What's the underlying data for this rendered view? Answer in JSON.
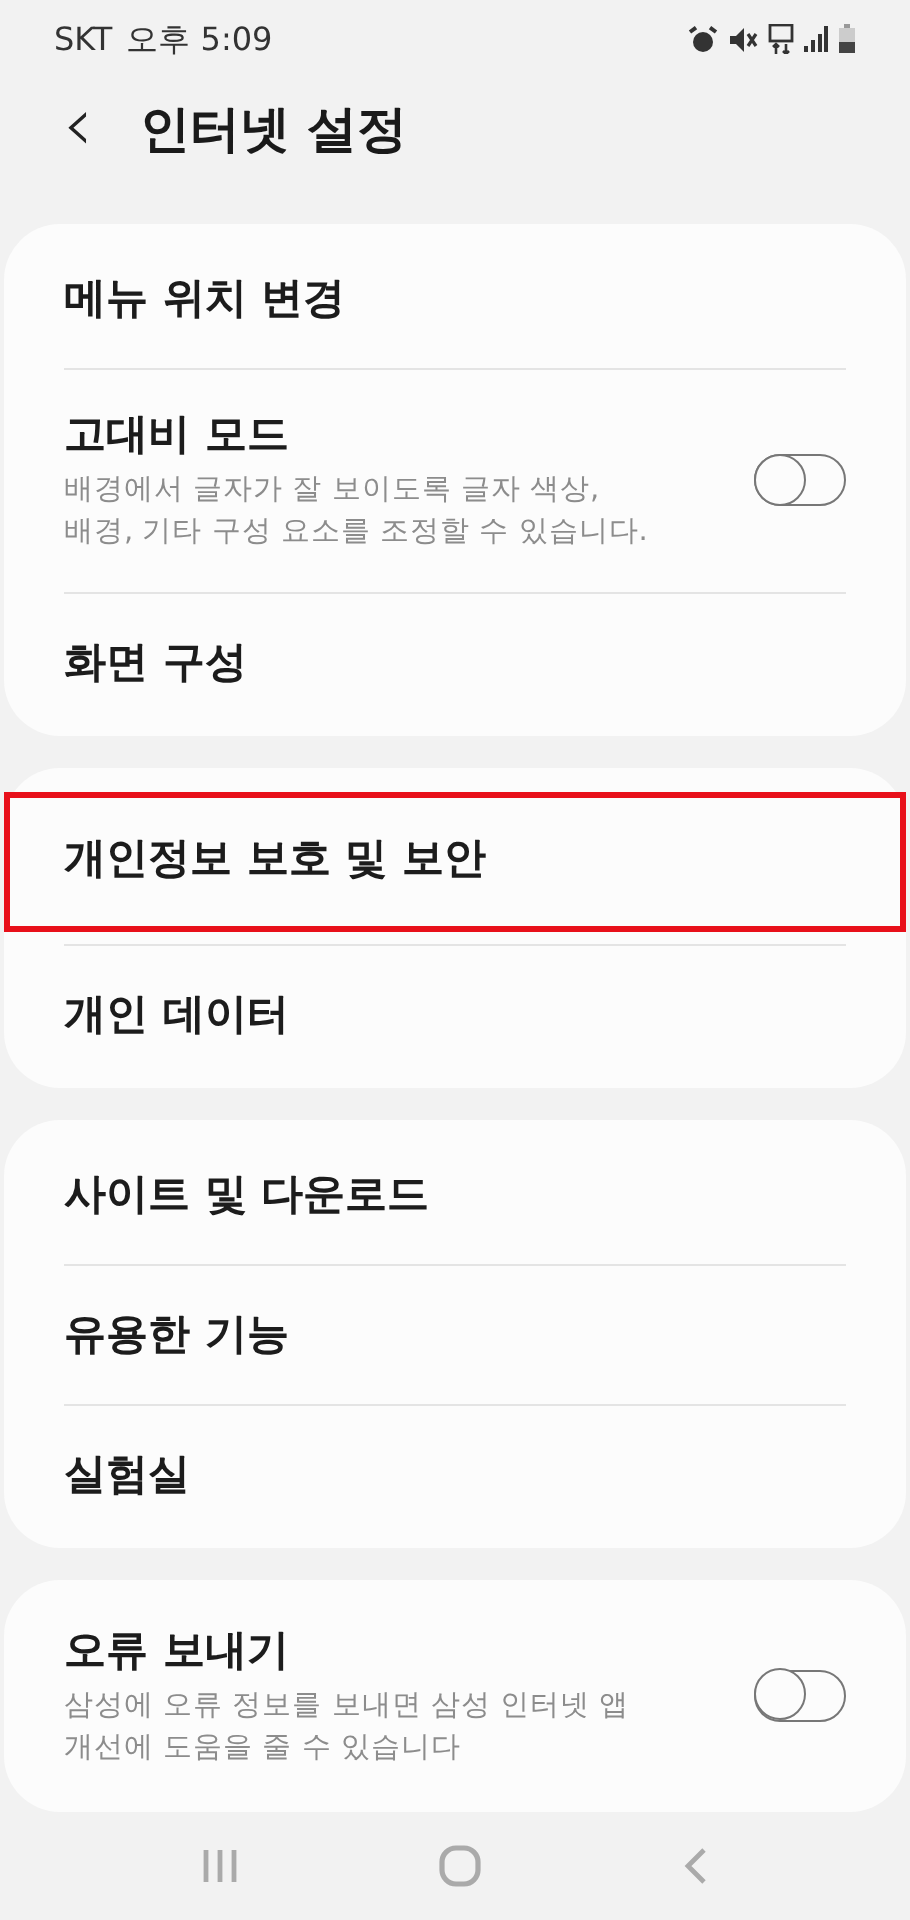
{
  "status_bar": {
    "carrier": "SKT",
    "time": "오후 5:09"
  },
  "header": {
    "back": "‹",
    "title": "인터넷 설정"
  },
  "groups": [
    {
      "items": [
        {
          "kind": "link",
          "title": "메뉴 위치 변경",
          "highlighted": false
        },
        {
          "kind": "toggle",
          "title": "고대비 모드",
          "subtitle": "배경에서 글자가 잘 보이도록 글자 색상, 배경, 기타 구성 요소를 조정할 수 있습니다.",
          "on": false,
          "highlighted": false
        },
        {
          "kind": "link",
          "title": "화면 구성",
          "highlighted": false
        }
      ]
    },
    {
      "items": [
        {
          "kind": "link",
          "title": "개인정보 보호 및 보안",
          "highlighted": true
        },
        {
          "kind": "link",
          "title": "개인 데이터",
          "highlighted": false
        }
      ]
    },
    {
      "items": [
        {
          "kind": "link",
          "title": "사이트 및 다운로드",
          "highlighted": false
        },
        {
          "kind": "link",
          "title": "유용한 기능",
          "highlighted": false
        },
        {
          "kind": "link",
          "title": "실험실",
          "highlighted": false
        }
      ]
    },
    {
      "items": [
        {
          "kind": "toggle",
          "title": "오류 보내기",
          "subtitle": "삼성에 오류 정보를 보내면 삼성 인터넷 앱 개선에 도움을 줄 수 있습니다",
          "on": false,
          "highlighted": false
        }
      ]
    }
  ]
}
